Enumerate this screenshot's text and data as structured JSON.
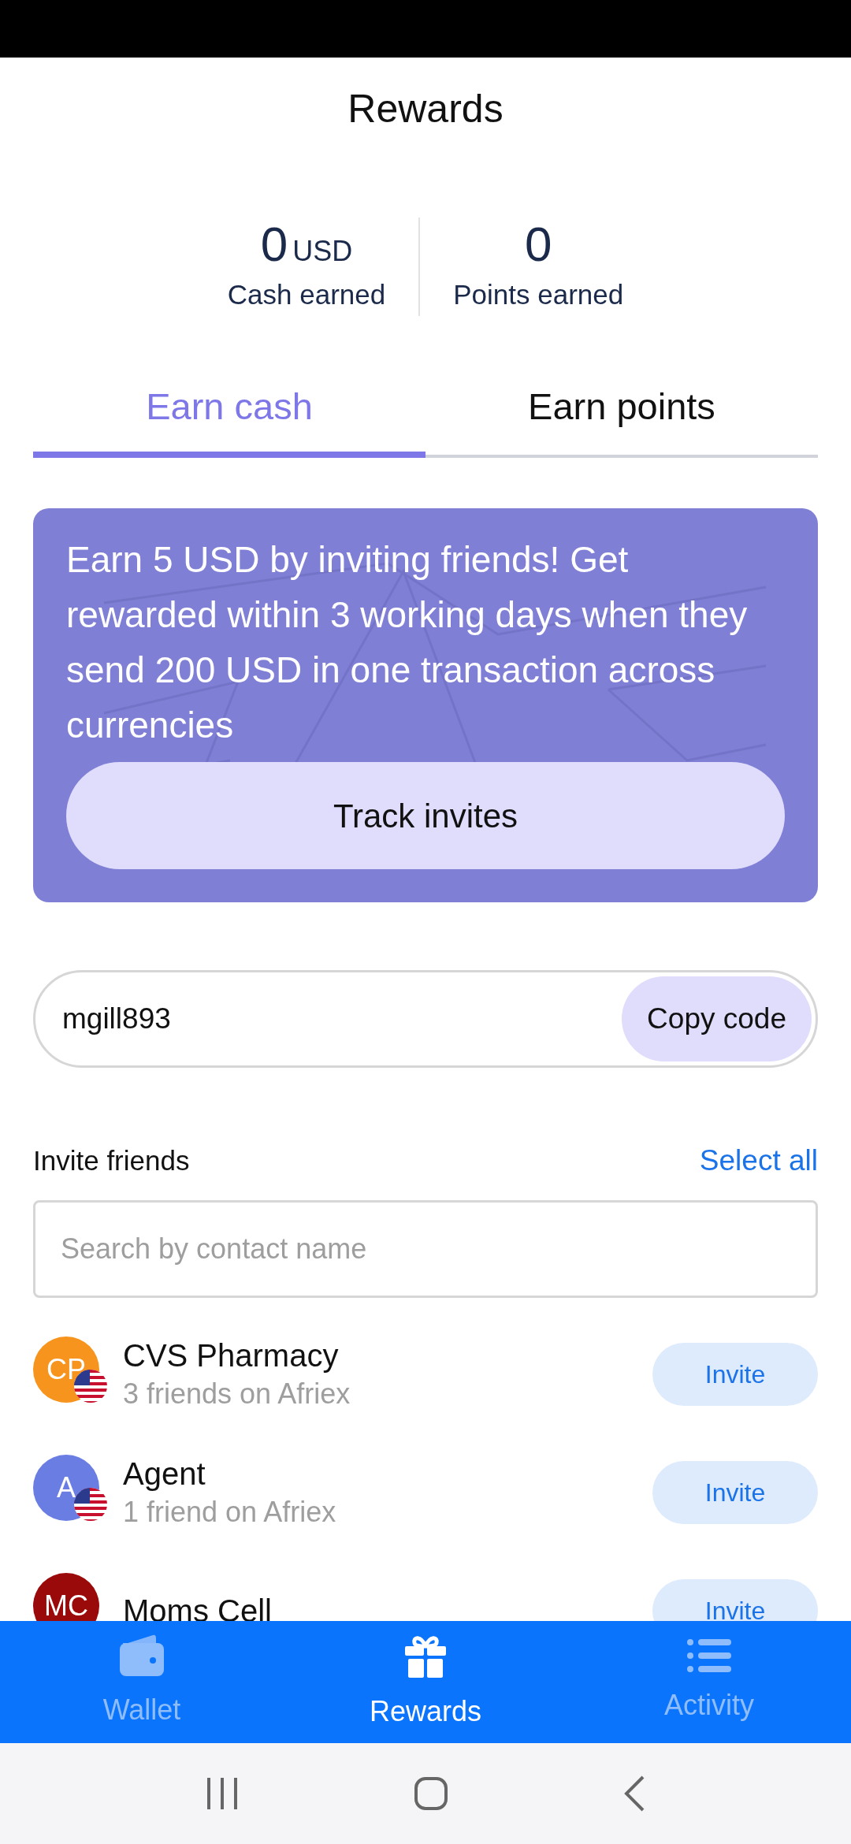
{
  "header": {
    "title": "Rewards"
  },
  "stats": [
    {
      "value": "0",
      "unit": "USD",
      "label": "Cash earned"
    },
    {
      "value": "0",
      "label": "Points earned"
    }
  ],
  "tabs": [
    {
      "label": "Earn cash",
      "selected": true
    },
    {
      "label": "Earn points",
      "selected": false
    }
  ],
  "promo": {
    "text": "Earn 5 USD by inviting friends! Get rewarded within 3 working days when they send 200 USD in one transaction across currencies",
    "button": "Track invites"
  },
  "referral": {
    "code": "mgill893",
    "button": "Copy code"
  },
  "invite_section": {
    "title": "Invite friends",
    "action": "Select all",
    "search": {
      "placeholder": "Search by contact name"
    }
  },
  "contacts": [
    {
      "initials": "CP",
      "color": "#f7941d",
      "name": "CVS Pharmacy",
      "subtitle": "3 friends on Afriex",
      "button": "Invite"
    },
    {
      "initials": "A",
      "color": "#6a7de3",
      "name": "Agent",
      "subtitle": "1 friend on Afriex",
      "button": "Invite"
    },
    {
      "initials": "MC",
      "color": "#9a0a0a",
      "name": "Moms Cell",
      "button": "Invite"
    }
  ],
  "bottom_nav": [
    {
      "label": "Wallet",
      "selected": false
    },
    {
      "label": "Rewards",
      "selected": true
    },
    {
      "label": "Activity",
      "selected": false
    }
  ]
}
